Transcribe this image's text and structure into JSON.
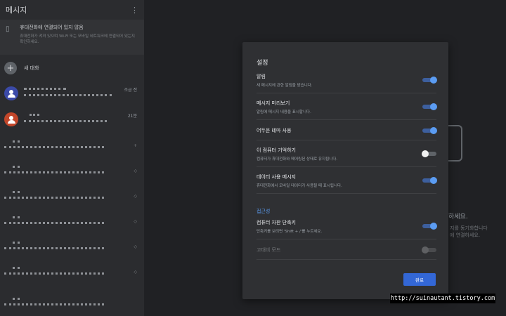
{
  "sidebar": {
    "title": "메시지",
    "banner": {
      "title": "휴대전화에 연결되어 있지 않음",
      "subtitle": "휴대전화가 켜져 있으며 Wi-Fi 또는 모바일 네트워크에 연결되어 있는지 확인하세요."
    },
    "new_chat_label": "새 대화",
    "conversations": [
      {
        "time": "조금 전",
        "avatar_color": "#3b4aa8"
      },
      {
        "time": "21분",
        "avatar_color": "#c2462a"
      }
    ]
  },
  "background": {
    "hint_title": "하세요.",
    "hint_sub": "지를 동기화합니다\n에 연결하세요."
  },
  "settings_dialog": {
    "title": "설정",
    "items": [
      {
        "label": "알림",
        "desc": "새 메시지에 관한 알림을 받습니다.",
        "state": "on"
      },
      {
        "label": "메시지 미리보기",
        "desc": "알림에 메시지 내용을 표시합니다.",
        "state": "on"
      },
      {
        "label": "어두운 테마 사용",
        "desc": "",
        "state": "on"
      },
      {
        "label": "이 컴퓨터 기억하기",
        "desc": "컴퓨터가 휴대전화와 페어링된 상태로 유지됩니다.",
        "state": "off"
      },
      {
        "label": "데이터 사용 메시지",
        "desc": "휴대전화에서 모바일 데이터가 사용될 때 표시됩니다.",
        "state": "on"
      }
    ],
    "accessibility_title": "접근성",
    "accessibility_items": [
      {
        "label": "컴퓨터 자판 단축키",
        "desc": "단축키를 보려면 'Shift + /'를 누르세요.",
        "state": "on"
      },
      {
        "label": "고대비 모드",
        "desc": "",
        "state": "disabled"
      }
    ],
    "done_label": "완료"
  },
  "watermark": "http://suinautant.tistory.com",
  "colors": {
    "accent": "#3367d6",
    "toggle_on": "#5b9cf2"
  }
}
